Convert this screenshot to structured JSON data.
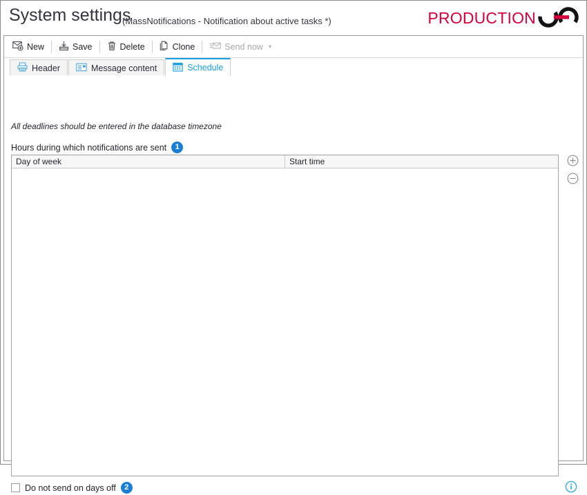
{
  "window": {
    "title": "System settings",
    "subtitle": "(MassNotifications - Notification about active tasks *)"
  },
  "brand": {
    "text": "PRODUCTION",
    "mark_icon": "chain-link-logo-icon",
    "color": "#d4003c",
    "mark_color": "#1a1a1a"
  },
  "toolbar": {
    "items": [
      {
        "label": "New",
        "icon": "envelope-plus-icon",
        "disabled": false
      },
      {
        "label": "Save",
        "icon": "save-disk-icon",
        "disabled": false
      },
      {
        "label": "Delete",
        "icon": "trash-icon",
        "disabled": false
      },
      {
        "label": "Clone",
        "icon": "copy-pages-icon",
        "disabled": false
      },
      {
        "label": "Send now",
        "icon": "send-envelope-icon",
        "disabled": true,
        "caret": "▾"
      }
    ]
  },
  "tabs": [
    {
      "label": "Header",
      "icon": "printer-icon",
      "active": false
    },
    {
      "label": "Message content",
      "icon": "message-card-icon",
      "active": false
    },
    {
      "label": "Schedule",
      "icon": "calendar-icon",
      "active": true
    }
  ],
  "schedule_panel": {
    "hint": "All deadlines should be entered in the database timezone",
    "section_label": "Hours during which notifications are sent",
    "section_badge": "1",
    "grid": {
      "columns": [
        "Day of week",
        "Start time"
      ],
      "rows": []
    },
    "add_button_icon": "plus-circle-icon",
    "remove_button_icon": "minus-circle-icon",
    "checkbox": {
      "label": "Do not send on days off",
      "checked": false,
      "badge": "2"
    },
    "info_button_icon": "info-circle-icon"
  },
  "colors": {
    "accent_blue": "#1a9fe0",
    "badge_blue": "#1a7fd4",
    "brand_red": "#d4003c"
  }
}
